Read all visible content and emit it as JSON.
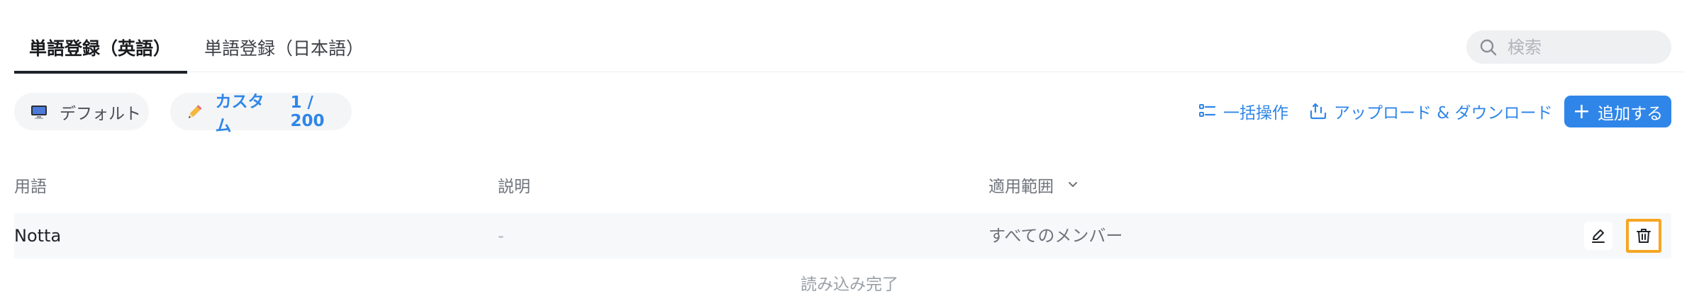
{
  "tabs": [
    {
      "label": "単語登録（英語）",
      "active": true
    },
    {
      "label": "単語登録（日本語）",
      "active": false
    }
  ],
  "search": {
    "placeholder": "検索",
    "value": ""
  },
  "filters": {
    "default_label": "デフォルト",
    "custom_label": "カスタム",
    "custom_count": "1 / 200"
  },
  "actions": {
    "batch_label": "一括操作",
    "upload_download_label": "アップロード & ダウンロード",
    "add_label": "追加する"
  },
  "table": {
    "headers": {
      "term": "用語",
      "description": "説明",
      "scope": "適用範囲"
    },
    "rows": [
      {
        "term": "Notta",
        "description": "-",
        "scope": "すべてのメンバー"
      }
    ]
  },
  "status": {
    "load_complete": "読み込み完了"
  },
  "colors": {
    "accent": "#2f86e8",
    "highlight": "#f5a623"
  }
}
